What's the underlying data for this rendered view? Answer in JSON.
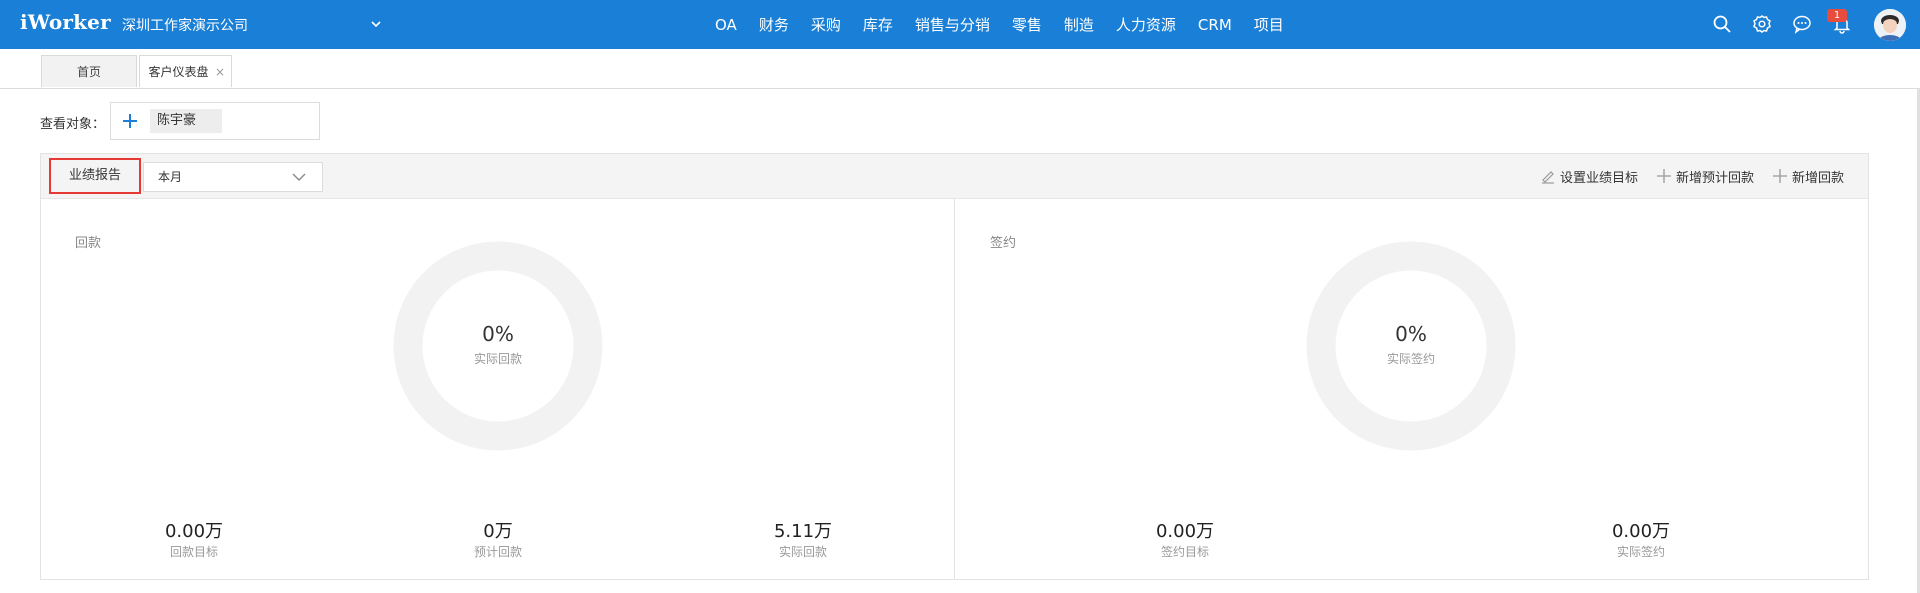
{
  "app": {
    "brand": "iWorker",
    "company": "深圳工作家演示公司",
    "nav": [
      "OA",
      "财务",
      "采购",
      "库存",
      "销售与分销",
      "零售",
      "制造",
      "人力资源",
      "CRM",
      "项目"
    ],
    "notification_count": "1"
  },
  "tabs": {
    "home": "首页",
    "active": "客户仪表盘",
    "close": "×"
  },
  "view": {
    "label": "查看对象：",
    "person": "陈宇豪"
  },
  "report": {
    "title": "业绩报告",
    "period": "本月",
    "actions": {
      "set_target": "设置业绩目标",
      "add_expected": "新增预计回款",
      "add_payment": "新增回款"
    }
  },
  "cards": {
    "payment": {
      "title": "回款",
      "percent": "0%",
      "center_label": "实际回款",
      "stats": [
        {
          "value": "0.00万",
          "label": "回款目标"
        },
        {
          "value": "0万",
          "label": "预计回款"
        },
        {
          "value": "5.11万",
          "label": "实际回款"
        }
      ]
    },
    "contract": {
      "title": "签约",
      "percent": "0%",
      "center_label": "实际签约",
      "stats": [
        {
          "value": "0.00万",
          "label": "签约目标"
        },
        {
          "value": "0.00万",
          "label": "实际签约"
        }
      ]
    }
  },
  "colors": {
    "topbar": "#1a7fd6",
    "highlight": "#e53935",
    "badge": "#e84c3d",
    "ring": "#f2f2f2"
  }
}
